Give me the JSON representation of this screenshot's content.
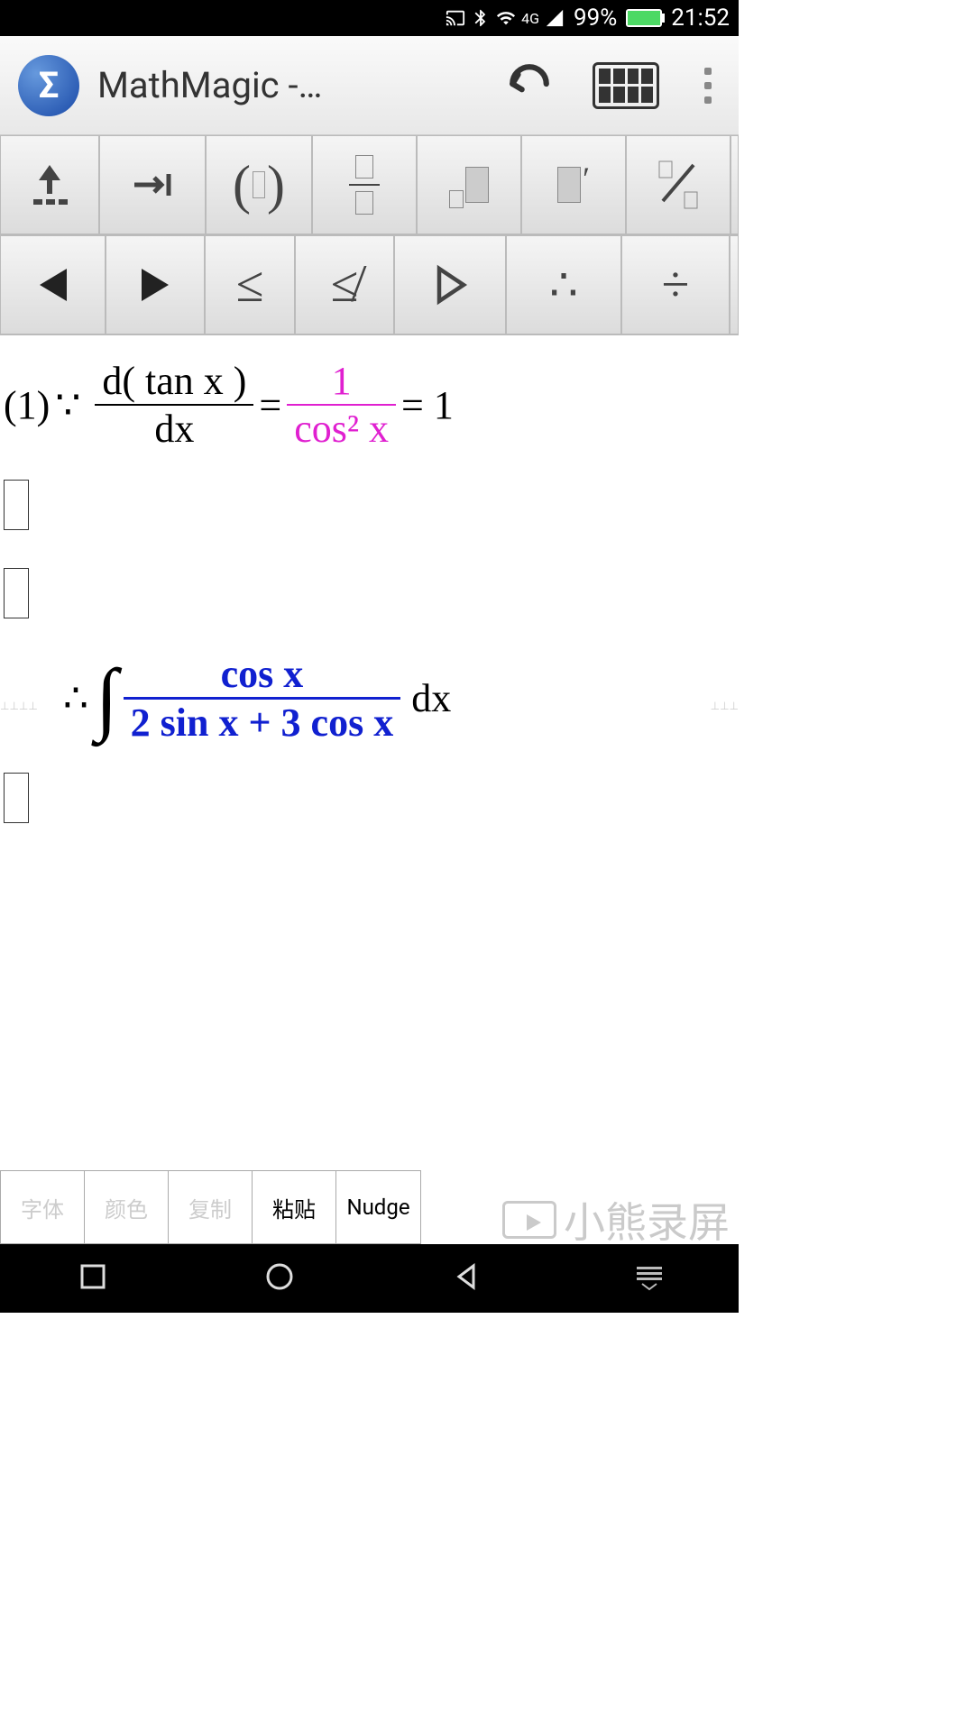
{
  "status": {
    "battery": "99%",
    "time": "21:52",
    "network": "4G"
  },
  "app": {
    "title": "MathMagic  -…",
    "icon_letter": "Σ"
  },
  "toolbar_row1": [
    "shift-up",
    "tab",
    "parens",
    "fraction",
    "sub-super-left",
    "super-prime",
    "slash-frac"
  ],
  "toolbar_row2": [
    "left-triangle",
    "right-triangle",
    "leq",
    "not-leq",
    "open-right-triangle",
    "therefore",
    "divide-dots"
  ],
  "equations": {
    "eq1_num1": "(1)",
    "eq1_because": "∵",
    "eq1_frac1_num": "d( tan x )",
    "eq1_frac1_den": "dx",
    "eq1_eq": " = ",
    "eq1_frac2_num": "1",
    "eq1_frac2_den": "cos² x",
    "eq1_eq2": " = 1",
    "eq2_therefore": "∴",
    "eq2_frac_num": "cos x",
    "eq2_frac_den": "2 sin x + 3 cos x",
    "eq2_dx": "dx"
  },
  "bottom_buttons": {
    "font": "字体",
    "color": "颜色",
    "copy": "复制",
    "paste": "粘贴",
    "nudge": "Nudge"
  },
  "watermark": "小熊录屏"
}
